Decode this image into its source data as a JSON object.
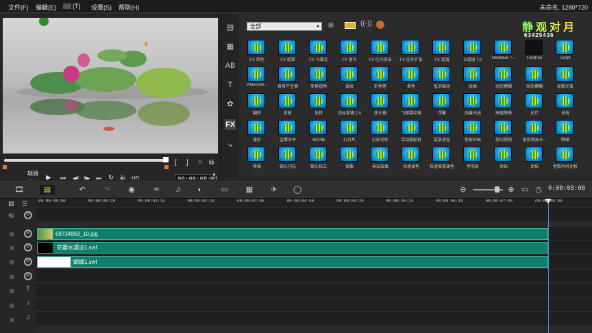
{
  "menubar": {
    "items": [
      "文件(F)",
      "编辑(E)",
      "(T)",
      "设置(S)",
      "帮助(H)"
    ],
    "window_title": "未命名, 1280*720"
  },
  "preview": {
    "mode_labels": [
      "项目",
      "素材"
    ],
    "bracket_in": "[",
    "bracket_out": "]",
    "hd_label": "HD",
    "timecode": "00:00:08:01"
  },
  "library": {
    "category": "全部",
    "watermark": "静观对月",
    "tiles": [
      "FX 单色",
      "FX 遮罩",
      "FX 马赛克",
      "FX 速写",
      "FX 往内挤压",
      "FX 往外扩张",
      "FX 涟漪",
      "G滤镜 7.0",
      "NewBlue 7...",
      "FotoPen",
      "Script",
      "Vitascene...",
      "背景产生器",
      "变换视频",
      "波纹",
      "彩色笔",
      "单色",
      "抵消摇动",
      "绘画",
      "动态模糊",
      "动态模糊",
      "发散光束",
      "翻转",
      "反射",
      "反转",
      "仿标准镜 2.0",
      "放大镜",
      "飞翔雷中蒸",
      "浮雕",
      "改善光线",
      "高级降噪",
      "光芒",
      "光线",
      "漫反",
      "金螺水平",
      "画中画",
      "幻灯片",
      "幻影动作",
      "活动摄影机",
      "肌肤滤色",
      "剪影外框",
      "剪切视频",
      "渐变填充卡...",
      "降噪",
      "降噪",
      "镜头闪光",
      "镜头校正",
      "镜像",
      "景深效果",
      "快速调色",
      "快速摇摆调色",
      "老电影",
      "涂抹",
      "涂抹",
      "老照片时光机"
    ],
    "fotopen_text": "63425436"
  },
  "toolbar": {
    "time": "0:00:08:08"
  },
  "ruler": {
    "ticks": [
      "00:00:00:00",
      "00:00:00:20",
      "00:00:01:15",
      "00:00:02:10",
      "00:00:03:05",
      "00:00:04:00",
      "00:00:04:20",
      "00:00:05:15",
      "00:00:06:10",
      "00:00:07:05",
      "00:00:08:00"
    ]
  },
  "tracks": {
    "clips": [
      "68734863_10.jpg",
      "花瓣水漂没1.swf",
      "蝴蝶1.swf"
    ]
  },
  "colors": {
    "clip_fill": "#0e7f6a",
    "playhead": "#4a8ad8",
    "effect_thumb": "#0a8ad6"
  }
}
